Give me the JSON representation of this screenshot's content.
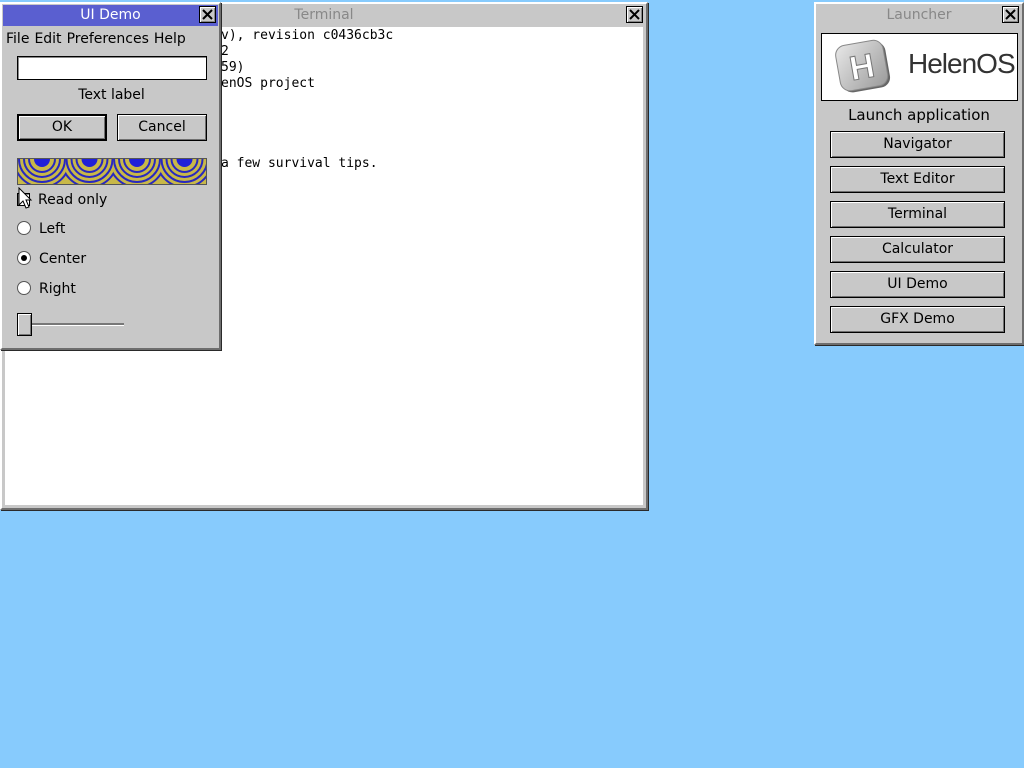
{
  "terminal": {
    "title": "Terminal",
    "lines": [
      "v), revision c0436cb3c",
      "2",
      "59)",
      "enOS project",
      "a few survival tips."
    ]
  },
  "uidemo": {
    "title": "UI Demo",
    "menu": [
      "File",
      "Edit",
      "Preferences",
      "Help"
    ],
    "text_input": {
      "value": "",
      "placeholder": ""
    },
    "text_label": "Text label",
    "ok_label": "OK",
    "cancel_label": "Cancel",
    "checkbox": {
      "label": "Read only",
      "checked": false
    },
    "radios": [
      {
        "label": "Left",
        "checked": false
      },
      {
        "label": "Center",
        "checked": true
      },
      {
        "label": "Right",
        "checked": false
      }
    ],
    "slider_value": 0
  },
  "launcher": {
    "title": "Launcher",
    "logo_text": "HelenOS",
    "logo_letter": "H",
    "heading": "Launch application",
    "buttons": [
      "Navigator",
      "Text Editor",
      "Terminal",
      "Calculator",
      "UI Demo",
      "GFX Demo"
    ]
  },
  "colors": {
    "desktop": "#87cbfd",
    "active_title": "#5a5fd0",
    "window_face": "#c8c8c8"
  }
}
